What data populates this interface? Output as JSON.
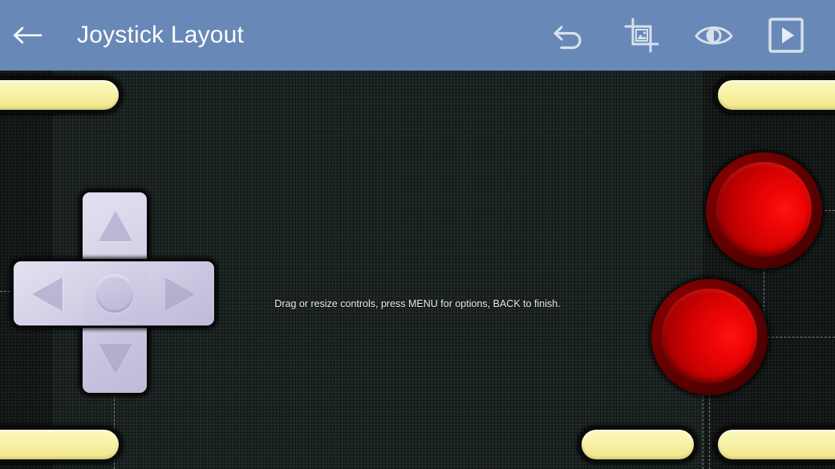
{
  "titlebar": {
    "title": "Joystick Layout",
    "back_icon": "back-arrow-icon",
    "tools": [
      {
        "name": "undo-icon",
        "label": "Undo"
      },
      {
        "name": "crop-icon",
        "label": "Crop"
      },
      {
        "name": "eye-icon",
        "label": "Preview"
      },
      {
        "name": "play-icon",
        "label": "Play"
      }
    ],
    "background_color": "#6888b8",
    "text_color": "#ffffff"
  },
  "canvas": {
    "hint": "Drag or resize controls, press MENU for options, BACK to finish.",
    "background_color": "#1d2624",
    "margin_color": "#161b1a",
    "guide_color": "#cdd2d0"
  },
  "controls": {
    "dpad": {
      "name": "dpad-control",
      "directions": [
        "up",
        "down",
        "left",
        "right"
      ],
      "color": "#d6d3e8"
    },
    "round_buttons": [
      {
        "name": "round-button-a",
        "color": "#d40202"
      },
      {
        "name": "round-button-b",
        "color": "#d40202"
      }
    ],
    "pill_buttons": [
      {
        "name": "pill-button-top-left",
        "color": "#f8f3a9"
      },
      {
        "name": "pill-button-top-right",
        "color": "#f8f3a9"
      },
      {
        "name": "pill-button-bottom-left",
        "color": "#f8f3a9"
      },
      {
        "name": "pill-button-bottom-center",
        "color": "#f8f3a9"
      },
      {
        "name": "pill-button-bottom-right",
        "color": "#f8f3a9"
      }
    ]
  }
}
